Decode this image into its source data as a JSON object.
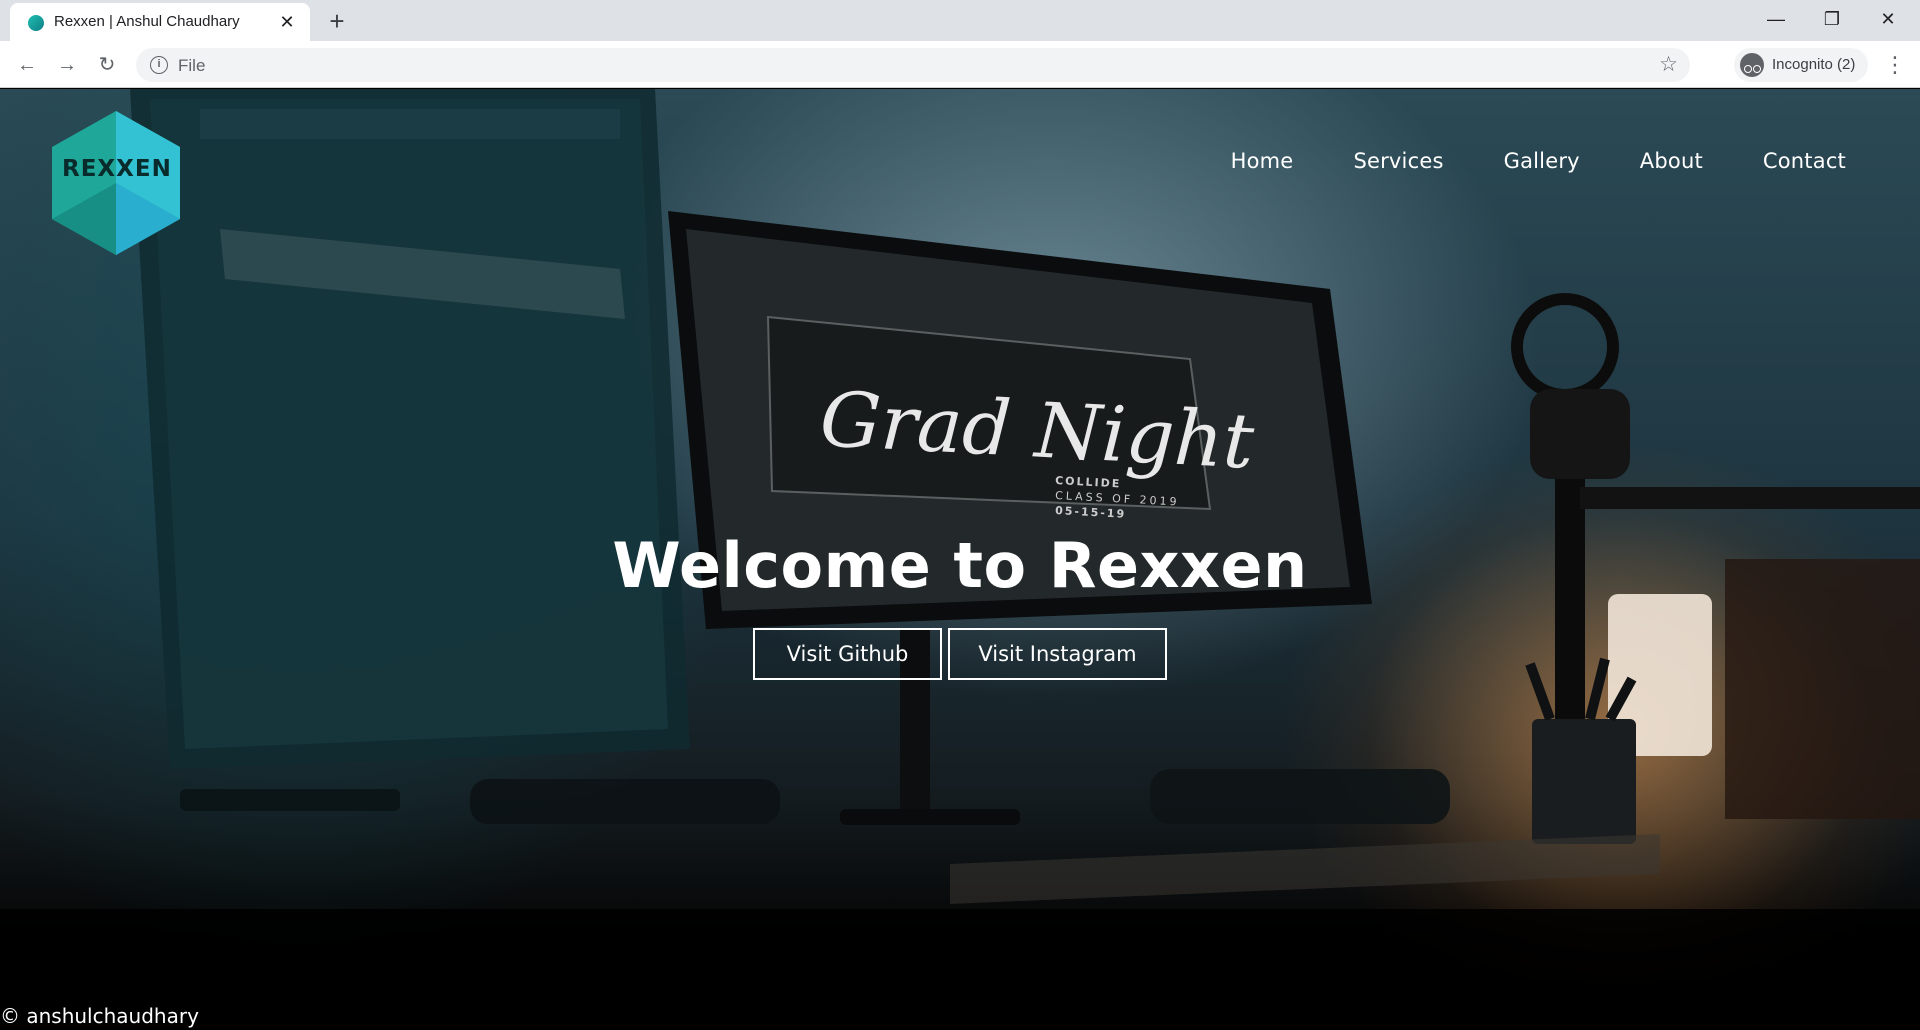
{
  "browser": {
    "tab_title": "Rexxen | Anshul Chaudhary",
    "tab_close": "✕",
    "new_tab": "+",
    "window_controls": {
      "minimize": "—",
      "restore": "❐",
      "close": "✕"
    },
    "nav": {
      "back": "←",
      "forward": "→",
      "reload": "↻"
    },
    "address": {
      "scheme": "File",
      "info_icon": "i",
      "star": "☆"
    },
    "incognito_label": "Incognito (2)",
    "menu": "⋮"
  },
  "site": {
    "logo_text": "REXXEN",
    "nav_items": [
      "Home",
      "Services",
      "Gallery",
      "About",
      "Contact"
    ],
    "hero_title": "Welcome to Rexxen",
    "buttons": {
      "github": "Visit Github",
      "instagram": "Visit Instagram"
    },
    "footer": "© anshulchaudhary",
    "screen_text": {
      "script": "Grad Night",
      "line1": "COLLIDE",
      "line2": "CLASS OF 2019",
      "line3": "05-15-19"
    },
    "colors": {
      "logo_teal": "#1fa89a",
      "logo_cyan": "#33c2d4",
      "text": "#ffffff"
    }
  }
}
